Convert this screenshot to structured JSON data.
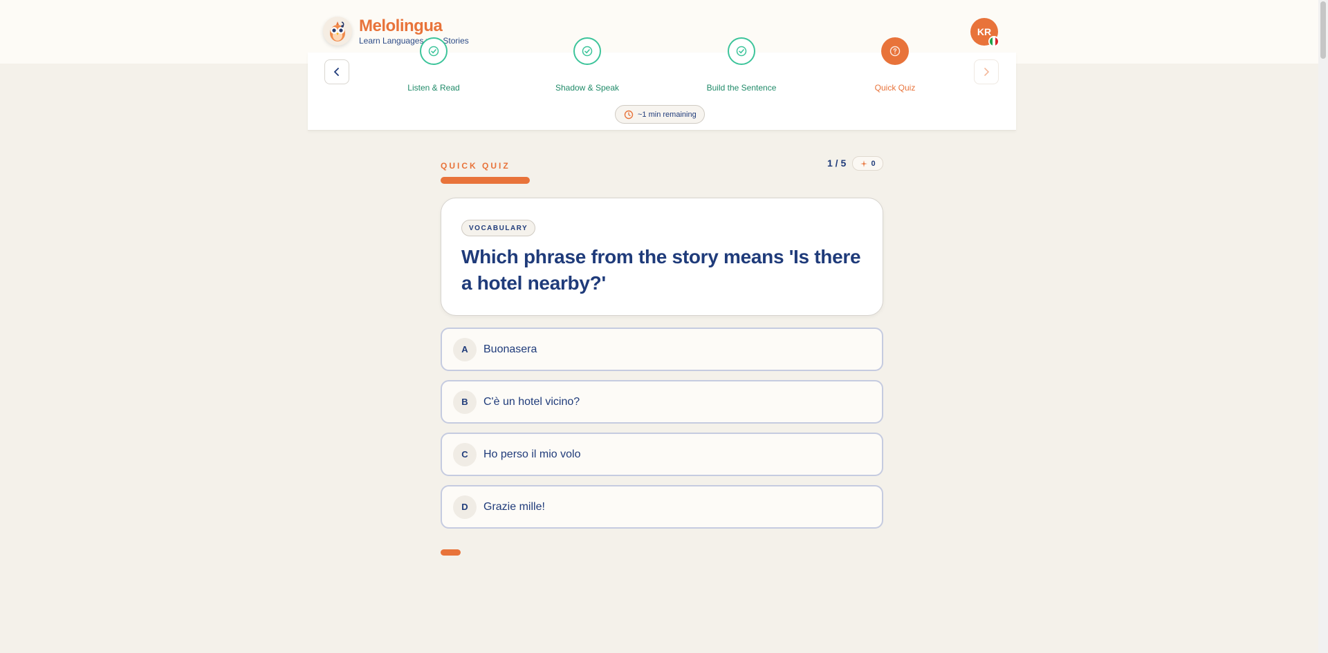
{
  "brand": {
    "name": "Melolingua",
    "tagline": "Learn Languages with Stories"
  },
  "user": {
    "initials": "KR",
    "flag_colors": [
      "#1ea34a",
      "#ffffff",
      "#d8262c"
    ]
  },
  "steps": [
    {
      "label": "Listen & Read",
      "status": "complete"
    },
    {
      "label": "Shadow & Speak",
      "status": "complete"
    },
    {
      "label": "Build the Sentence",
      "status": "complete"
    },
    {
      "label": "Quick Quiz",
      "status": "active"
    }
  ],
  "time_remaining": "~1 min remaining",
  "quiz": {
    "label": "QUICK QUIZ",
    "counter": "1 / 5",
    "score": "0",
    "tag": "VOCABULARY",
    "question": "Which phrase from the story means 'Is there a hotel nearby?'",
    "options": [
      {
        "letter": "A",
        "text": "Buonasera"
      },
      {
        "letter": "B",
        "text": "C'è un hotel vicino?"
      },
      {
        "letter": "C",
        "text": "Ho perso il mio volo"
      },
      {
        "letter": "D",
        "text": "Grazie mille!"
      }
    ]
  },
  "colors": {
    "accent": "#e8733a",
    "primary_text": "#1f3b7a",
    "complete": "#3cc49a",
    "background": "#f4f1ea"
  }
}
